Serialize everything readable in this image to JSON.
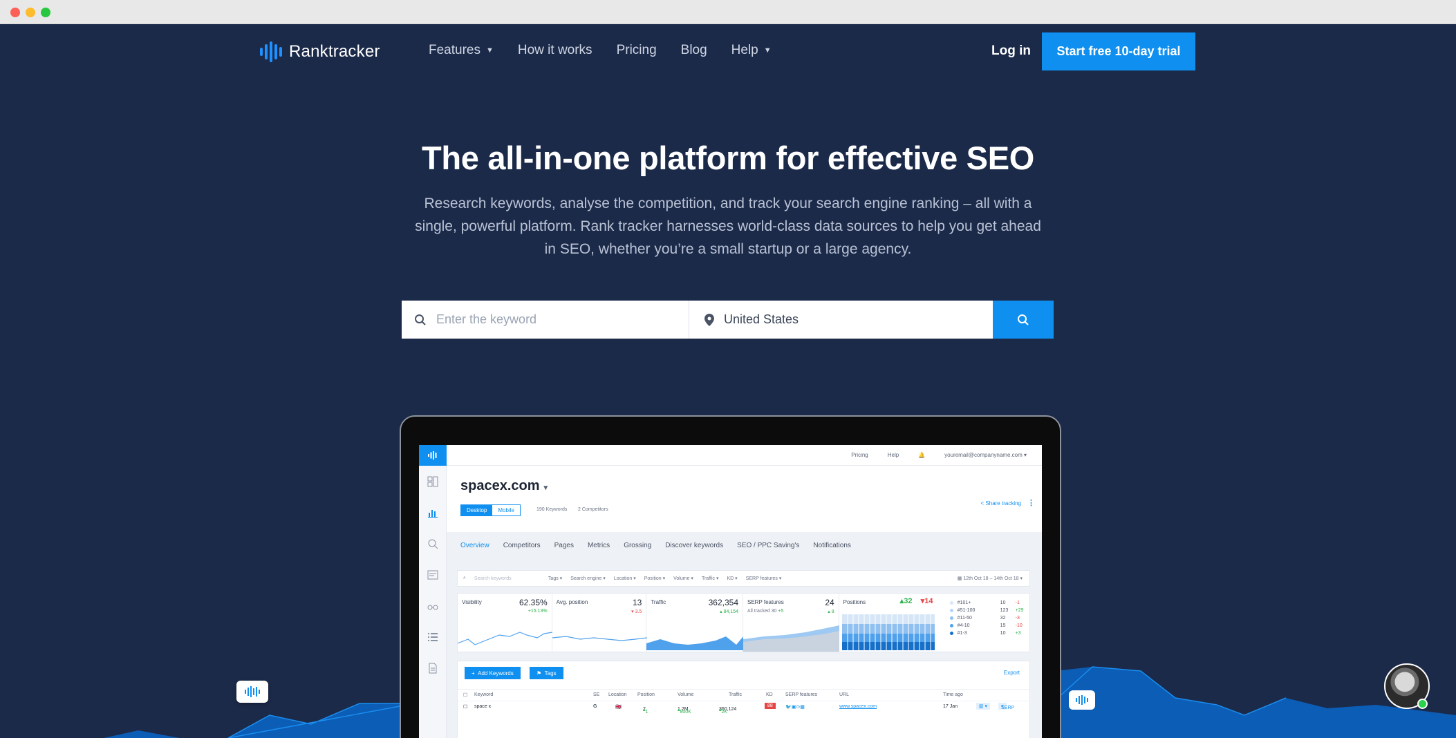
{
  "nav": {
    "logo_text": "Ranktracker",
    "items": [
      {
        "label": "Features",
        "has_dropdown": true
      },
      {
        "label": "How it works",
        "has_dropdown": false
      },
      {
        "label": "Pricing",
        "has_dropdown": false
      },
      {
        "label": "Blog",
        "has_dropdown": false
      },
      {
        "label": "Help",
        "has_dropdown": true
      }
    ],
    "login": "Log in",
    "cta": "Start free 10-day trial"
  },
  "hero": {
    "title": "The all-in-one platform for effective SEO",
    "subtitle": "Research keywords, analyse the competition, and track your search engine ranking – all with a single, powerful platform. Rank tracker harnesses world-class data sources to help you get ahead in SEO, whether you’re a small startup or a large agency."
  },
  "search": {
    "keyword_placeholder": "Enter the keyword",
    "location_value": "United States"
  },
  "app": {
    "topbar": {
      "pricing": "Pricing",
      "help": "Help",
      "email": "youremail@companyname.com"
    },
    "domain": "spacex.com",
    "device_tabs": [
      "Desktop",
      "Mobile"
    ],
    "keywords_count": "190 Keywords",
    "competitors_count": "2 Competitors",
    "share": "Share tracking",
    "tabs": [
      "Overview",
      "Competitors",
      "Pages",
      "Metrics",
      "Grossing",
      "Discover keywords",
      "SEO / PPC Saving's",
      "Notifications"
    ],
    "filters": {
      "search_placeholder": "Search keywords",
      "items": [
        "Tags",
        "Search engine",
        "Location",
        "Position",
        "Volume",
        "Traffic",
        "KD",
        "SERP features"
      ],
      "date_range": "12th Oct 18 – 14th Oct 18"
    },
    "metrics": {
      "visibility": {
        "label": "Visibility",
        "value": "62.35%",
        "delta": "+15.13%"
      },
      "avg_position": {
        "label": "Avg. position",
        "value": "13",
        "delta": "3.5"
      },
      "traffic": {
        "label": "Traffic",
        "value": "362,354",
        "delta": "84,154"
      },
      "serp": {
        "label": "SERP features",
        "value": "24",
        "sub": "All tracked 30",
        "sub_delta": "+5",
        "delta": "8"
      },
      "positions": {
        "label": "Positions",
        "up": "32",
        "down": "14"
      }
    },
    "position_legend": [
      {
        "label": "#101+",
        "count": "10",
        "delta": "-1",
        "color": "#d6e6f7"
      },
      {
        "label": "#51-100",
        "count": "123",
        "delta": "+29",
        "color": "#b7d5f4"
      },
      {
        "label": "#11-50",
        "count": "32",
        "delta": "-3",
        "color": "#8fc0f0"
      },
      {
        "label": "#4-10",
        "count": "15",
        "delta": "-10",
        "color": "#4fa1ec"
      },
      {
        "label": "#1-3",
        "count": "10",
        "delta": "+3",
        "color": "#1670c9"
      }
    ],
    "table": {
      "add_keywords": "Add Keywords",
      "tags": "Tags",
      "export": "Export",
      "columns": [
        "Keyword",
        "SE",
        "Location",
        "Position",
        "Volume",
        "Traffic",
        "KD",
        "SERP features",
        "URL",
        "Time ago"
      ],
      "row": {
        "keyword": "space x",
        "se": "G",
        "position": "2",
        "position_delta": "1",
        "volume": "1.2M",
        "volume_delta": "800K",
        "traffic": "360,124",
        "traffic_delta": "2K",
        "kd": "88",
        "url": "www.spacex.com",
        "time": "17 Jan",
        "serp_btn": "SERP"
      }
    }
  },
  "colors": {
    "background": "#1c2a4a",
    "accent": "#0f8fef",
    "hill": "#0b5db5"
  }
}
